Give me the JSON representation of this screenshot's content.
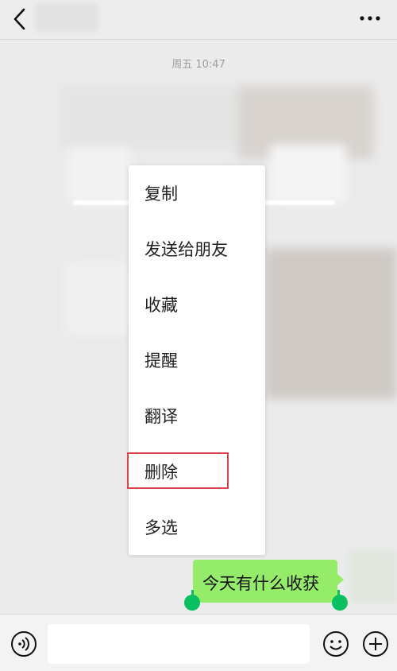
{
  "header": {
    "back_icon": "chevron-left-icon",
    "more_icon": "more-dots-icon"
  },
  "chat": {
    "timestamp": "周五 10:47",
    "bubble_text": "今天有什么收获"
  },
  "context_menu": {
    "items": [
      {
        "label": "复制"
      },
      {
        "label": "发送给朋友"
      },
      {
        "label": "收藏"
      },
      {
        "label": "提醒"
      },
      {
        "label": "翻译"
      },
      {
        "label": "删除"
      },
      {
        "label": "多选"
      }
    ],
    "highlight_color": "#d9434b"
  },
  "input_bar": {
    "voice_icon": "voice-icon",
    "emoji_icon": "emoji-icon",
    "plus_icon": "plus-icon"
  },
  "colors": {
    "bubble": "#95ec69",
    "handle": "#07c160",
    "background": "#ebebeb"
  }
}
